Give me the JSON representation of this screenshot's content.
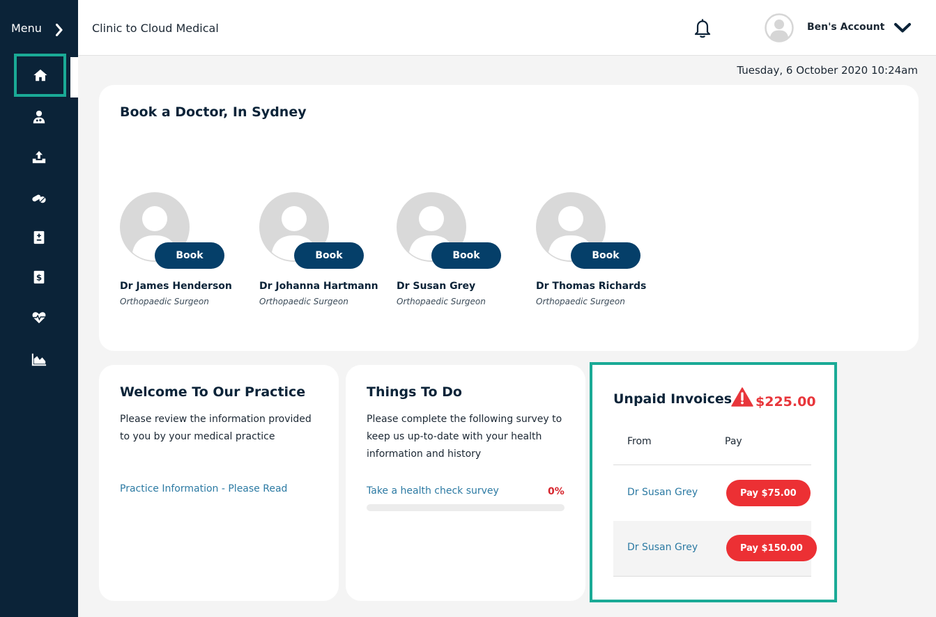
{
  "sidebar": {
    "menu_label": "Menu",
    "items": [
      {
        "icon": "home-icon"
      },
      {
        "icon": "doctor-icon"
      },
      {
        "icon": "upload-icon"
      },
      {
        "icon": "pills-icon"
      },
      {
        "icon": "medical-file-icon"
      },
      {
        "icon": "invoice-dollar-icon"
      },
      {
        "icon": "heartbeat-icon"
      },
      {
        "icon": "area-chart-icon"
      }
    ]
  },
  "header": {
    "brand": "Clinic to Cloud Medical",
    "account_label": "Ben's Account"
  },
  "datetime": "Tuesday, 6 October 2020 10:24am",
  "doctors": {
    "title": "Book a Doctor, In Sydney",
    "book_label": "Book",
    "list": [
      {
        "name": "Dr James Henderson",
        "specialty": "Orthopaedic Surgeon"
      },
      {
        "name": "Dr Johanna Hartmann",
        "specialty": "Orthopaedic Surgeon"
      },
      {
        "name": "Dr Susan Grey",
        "specialty": "Orthopaedic Surgeon"
      },
      {
        "name": "Dr Thomas Richards",
        "specialty": "Orthopaedic Surgeon"
      }
    ]
  },
  "welcome": {
    "title": "Welcome To Our Practice",
    "text": "Please review the information provided to you by your medical practice",
    "link": "Practice Information - Please Read"
  },
  "todo": {
    "title": "Things To Do",
    "text": "Please complete the following survey to keep us up-to-date with your health information and history",
    "survey_link": "Take a health check survey",
    "progress_label": "0%",
    "progress": 0
  },
  "invoices": {
    "title": "Unpaid Invoices",
    "total": "$225.00",
    "col_from": "From",
    "col_pay": "Pay",
    "rows": [
      {
        "from": "Dr Susan Grey",
        "pay_label": "Pay $75.00"
      },
      {
        "from": "Dr Susan Grey",
        "pay_label": "Pay $150.00"
      }
    ]
  },
  "colors": {
    "sidebar": "#0b2338",
    "accent": "#1aaa96",
    "primary_button": "#053f69",
    "pay_button": "#ec3034",
    "link": "#2c7aa3"
  }
}
